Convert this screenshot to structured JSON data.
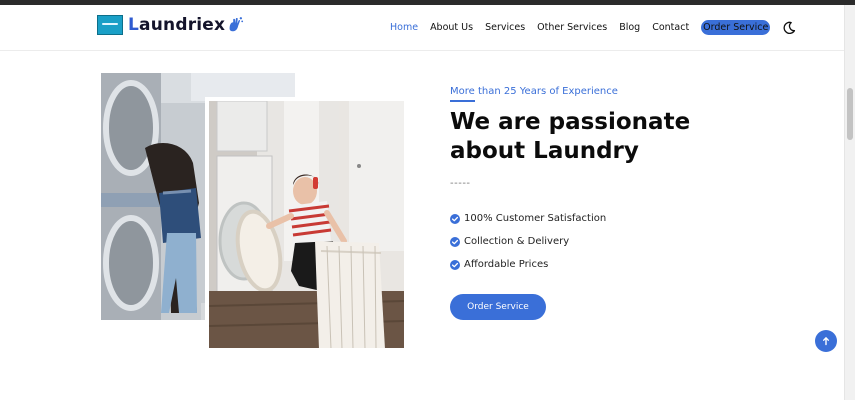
{
  "header": {
    "logo_initial": "L",
    "logo_rest": "aundriex",
    "nav": [
      {
        "label": "Home",
        "active": true
      },
      {
        "label": "About Us"
      },
      {
        "label": "Services"
      },
      {
        "label": "Other Services"
      },
      {
        "label": "Blog"
      },
      {
        "label": "Contact"
      }
    ],
    "order_label": "Order Service",
    "theme_icon": "moon-icon"
  },
  "hero": {
    "eyebrow": "More than 25 Years of Experience",
    "title": "We are passionate about Laundry",
    "divider": "-----",
    "features": [
      "100% Customer Satisfaction",
      "Collection & Delivery",
      "Affordable Prices"
    ],
    "cta_label": "Order Service"
  },
  "colors": {
    "accent": "#3a6fd8",
    "heading": "#0b0b0b"
  },
  "icons": {
    "check": "check-circle-icon",
    "back_to_top": "arrow-up-icon"
  }
}
